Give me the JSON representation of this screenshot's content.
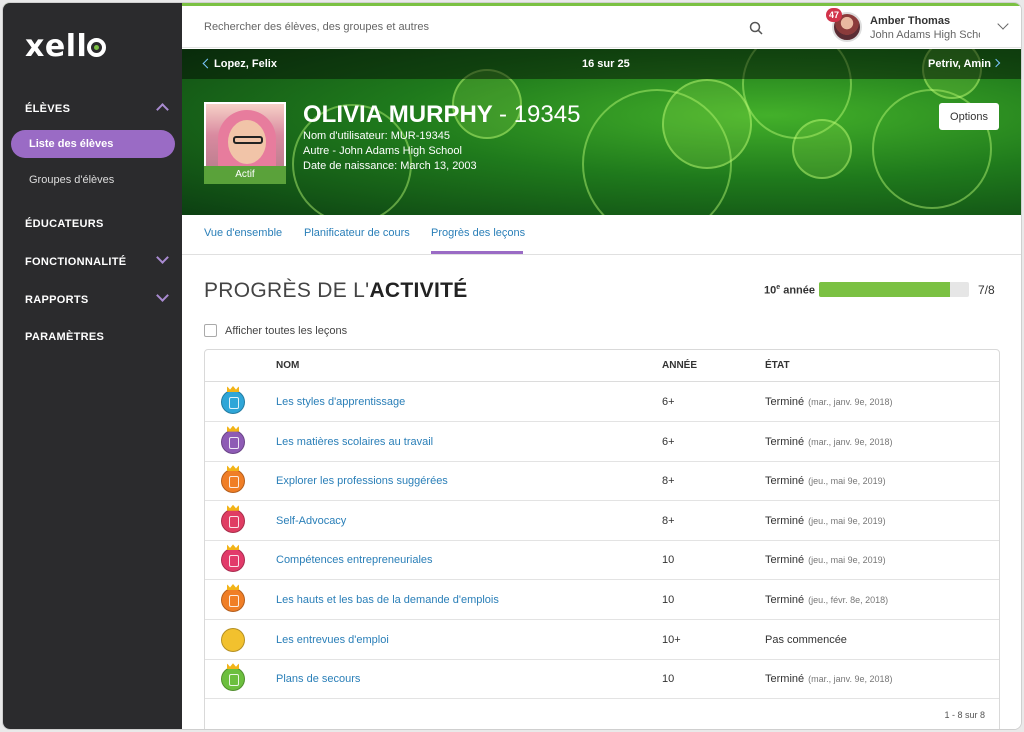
{
  "sidebar": {
    "logo": "xello",
    "sections": [
      {
        "label": "ÉLÈVES"
      },
      {
        "label": "ÉDUCATEURS"
      },
      {
        "label": "FONCTIONNALITÉ"
      },
      {
        "label": "RAPPORTS"
      },
      {
        "label": "PARAMÈTRES"
      }
    ],
    "subitems": [
      {
        "label": "Liste des élèves"
      },
      {
        "label": "Groupes d'élèves"
      }
    ]
  },
  "header": {
    "search_placeholder": "Rechercher des élèves, des groupes et autres",
    "notification_count": "47",
    "user_name": "Amber Thomas",
    "user_school": "John Adams High School"
  },
  "banner": {
    "prev_student": "Lopez, Felix",
    "counter": "16 sur 25",
    "next_student": "Petriv, Amin",
    "student_name": "OLIVIA MURPHY",
    "student_number": "- 19345",
    "username": "Nom d'utilisateur: MUR-19345",
    "school": "Autre - John Adams High School",
    "birthdate": "Date de naissance: March 13, 2003",
    "status": "Actif",
    "options": "Options"
  },
  "tabs": [
    {
      "label": "Vue d'ensemble"
    },
    {
      "label": "Planificateur de cours"
    },
    {
      "label": "Progrès des leçons"
    }
  ],
  "main": {
    "title_prefix": "PROGRÈS DE L'",
    "title_bold": "ACTIVITÉ",
    "grade_label": "10",
    "grade_sup": "e",
    "grade_suffix": " année",
    "progress_value": 7,
    "progress_max": 8,
    "progress_text": "7/8",
    "show_all_label": "Afficher toutes les leçons",
    "columns": {
      "name": "NOM",
      "year": "ANNÉE",
      "state": "ÉTAT"
    },
    "pagination": "1 - 8 sur 8",
    "lessons": [
      {
        "name": "Les styles d'apprentissage",
        "year": "6+",
        "state": "Terminé",
        "date": "(mar., janv. 9e, 2018)",
        "color": "#2fa6d8"
      },
      {
        "name": "Les matières scolaires au travail",
        "year": "6+",
        "state": "Terminé",
        "date": "(mar., janv. 9e, 2018)",
        "color": "#8e5bb5"
      },
      {
        "name": "Explorer les professions suggérées",
        "year": "8+",
        "state": "Terminé",
        "date": "(jeu., mai 9e, 2019)",
        "color": "#f07e26"
      },
      {
        "name": "Self-Advocacy",
        "year": "8+",
        "state": "Terminé",
        "date": "(jeu., mai 9e, 2019)",
        "color": "#e03d63"
      },
      {
        "name": "Compétences entrepreneuriales",
        "year": "10",
        "state": "Terminé",
        "date": "(jeu., mai 9e, 2019)",
        "color": "#e23a6a"
      },
      {
        "name": "Les hauts et les bas de la demande d'emplois",
        "year": "10",
        "state": "Terminé",
        "date": "(jeu., févr. 8e, 2018)",
        "color": "#f07e26"
      },
      {
        "name": "Les entrevues d'emploi",
        "year": "10+",
        "state": "Pas commencée",
        "date": "",
        "color": "#f2c12e"
      },
      {
        "name": "Plans de secours",
        "year": "10",
        "state": "Terminé",
        "date": "(mar., janv. 9e, 2018)",
        "color": "#6cbf3e"
      }
    ]
  },
  "colors": {
    "accent_purple": "#9a6bc5",
    "accent_green": "#7bc143",
    "link_blue": "#2a7fb8",
    "sidebar_bg": "#2b2b2d"
  }
}
